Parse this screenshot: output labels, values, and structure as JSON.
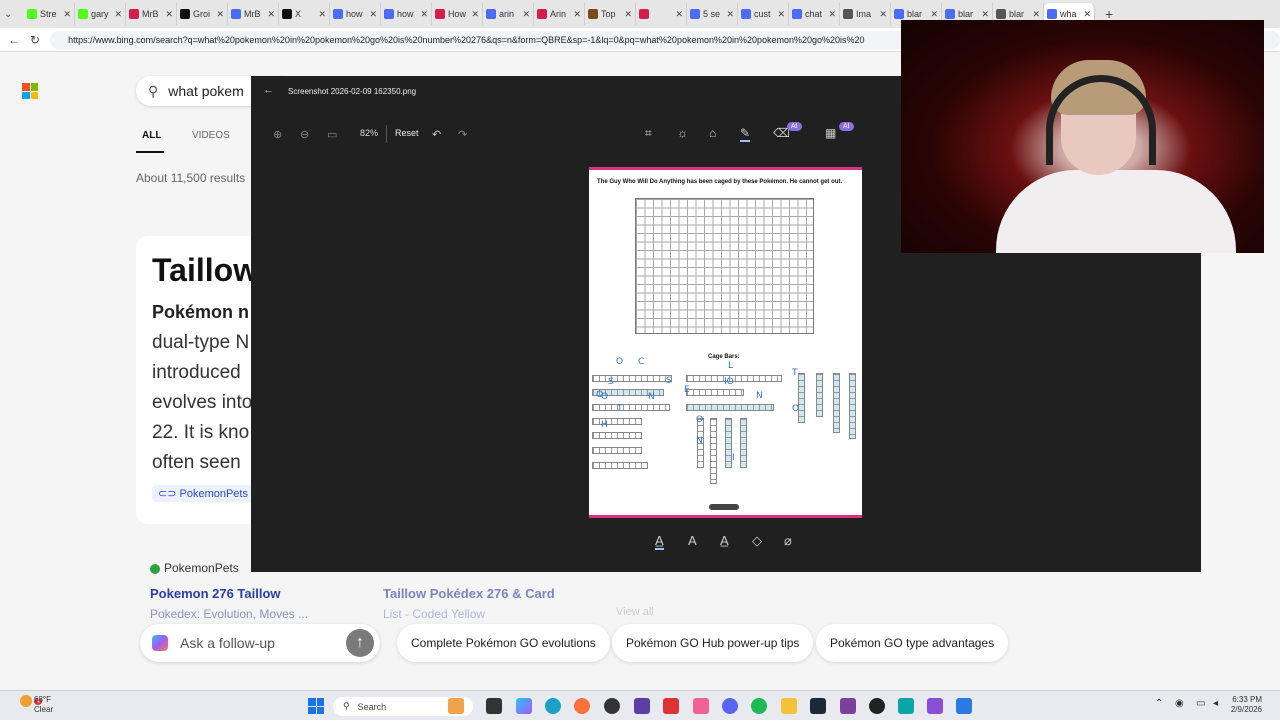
{
  "tabs": [
    {
      "label": "Stre",
      "color": "#53fc18"
    },
    {
      "label": "gary",
      "color": "#53fc18"
    },
    {
      "label": "MrB",
      "color": "#d51e4a"
    },
    {
      "label": "Groi",
      "color": "#111111"
    },
    {
      "label": "MrB",
      "color": "#4a6cf7"
    },
    {
      "label": "X",
      "color": "#111111"
    },
    {
      "label": "how",
      "color": "#4a6cf7"
    },
    {
      "label": "how",
      "color": "#4a6cf7"
    },
    {
      "label": "How",
      "color": "#d51e4a"
    },
    {
      "label": "arin",
      "color": "#4a6cf7"
    },
    {
      "label": "Arin",
      "color": "#d51e4a"
    },
    {
      "label": "Top",
      "color": "#7a4b1e"
    },
    {
      "label": "",
      "color": "#d51e4a"
    },
    {
      "label": "5 se",
      "color": "#4a6cf7"
    },
    {
      "label": "cust",
      "color": "#4a6cf7"
    },
    {
      "label": "chat",
      "color": "#4a6cf7"
    },
    {
      "label": "Ima",
      "color": "#555555"
    },
    {
      "label": "blar",
      "color": "#4a6cf7"
    },
    {
      "label": "blar",
      "color": "#4a6cf7"
    },
    {
      "label": "blar",
      "color": "#555555"
    },
    {
      "label": "wha",
      "color": "#4a6cf7"
    }
  ],
  "address": "https://www.bing.com/search?q=what%20pokemon%20in%20pokemon%20go%20is%20number%20276&qs=n&form=QBRE&sp=-1&lq=0&pq=what%20pokemon%20in%20pokemon%20go%20is%20",
  "bing": {
    "query": "what pokem",
    "tabs": {
      "all": "ALL",
      "videos": "VIDEOS"
    },
    "result_count": "About 11,500 results",
    "card": {
      "title": "Taillow",
      "subtitle": "Pokémon n",
      "lines": [
        "dual-type N",
        "introduced",
        "evolves into",
        "22. It is kno",
        "often seen"
      ],
      "source": "PokemonPets"
    },
    "results": [
      {
        "site": "PokemonPets",
        "title": "Pokemon 276 Taillow",
        "sub": "Pokedex: Evolution, Moves ..."
      },
      {
        "title": "Taillow Pokédex 276 & Card",
        "sub": "List - Coded Yellow"
      }
    ],
    "view_all": "View all",
    "ask_placeholder": "Ask a follow-up",
    "chips": [
      "Complete Pokémon GO evolutions",
      "Pokémon GO Hub power-up tips",
      "Pokémon GO type advantages"
    ]
  },
  "viewer": {
    "filename": "Screenshot 2026-02-09 162350.png",
    "zoom": "82%",
    "reset": "Reset",
    "ai_badge": "AI",
    "sheet": {
      "title": "The Guy Who Will Do Anything has been caged by these Pokémon. He cannot get out.",
      "cage_label": "Cage Bars:",
      "handwriting": [
        "O",
        "C",
        "S",
        "S",
        "N",
        "L",
        "IO",
        "N",
        "T",
        "O",
        "O",
        "H",
        "O",
        "N",
        "I",
        "T",
        "O",
        "E"
      ]
    }
  },
  "taskbar": {
    "weather_temp": "68°F",
    "weather_desc": "Clear",
    "notif_count": "4",
    "search": "Search",
    "time": "6:33 PM",
    "date": "2/9/2026"
  },
  "icons": [
    "back-icon",
    "refresh-icon",
    "search-icon",
    "zoom-in-icon",
    "zoom-out-icon",
    "crop-icon",
    "brightness-icon",
    "marker-icon",
    "pen-icon",
    "eraser-icon",
    "undo-icon",
    "redo-icon"
  ]
}
